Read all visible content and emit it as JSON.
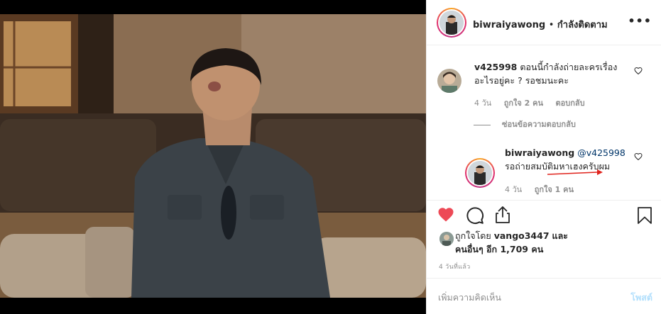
{
  "post": {
    "username": "biwraiyawong",
    "separator": "•",
    "follow_status": "กำลังติดตาม",
    "more_label": "•••"
  },
  "comments": [
    {
      "username": "v425998",
      "text_line1": "ตอนนี้กำลังถ่ายละครเรื่อง",
      "text_line2": "อะไรอยู่คะ ? รอชมนะคะ",
      "time": "4 วัน",
      "likes": "ถูกใจ 2 คน",
      "reply": "ตอบกลับ"
    }
  ],
  "hide_replies": "ซ่อนข้อความตอบกลับ",
  "reply": {
    "username": "biwraiyawong",
    "mention": "@v425998",
    "text": "รอถ่ายสมบัติมหาเฮงครับผม",
    "time": "4 วัน",
    "likes": "ถูกใจ 1 คน"
  },
  "liked_by": {
    "prefix": "ถูกใจโดย",
    "user": "vango3447",
    "and": "และ",
    "others_prefix": "คนอื่นๆ อีก",
    "others_count": "1,709",
    "others_suffix": "คน"
  },
  "timestamp": "4 วันที่แล้ว",
  "add_comment": {
    "placeholder": "เพิ่มความคิดเห็น",
    "post_button": "โพสต์"
  },
  "colors": {
    "like_red": "#ed4956",
    "annotation_arrow": "#e0231c",
    "link_blue": "#003569",
    "post_button_disabled": "#b2dffc"
  },
  "icons": [
    "heart-icon",
    "comment-icon",
    "share-icon",
    "bookmark-icon",
    "more-icon"
  ]
}
